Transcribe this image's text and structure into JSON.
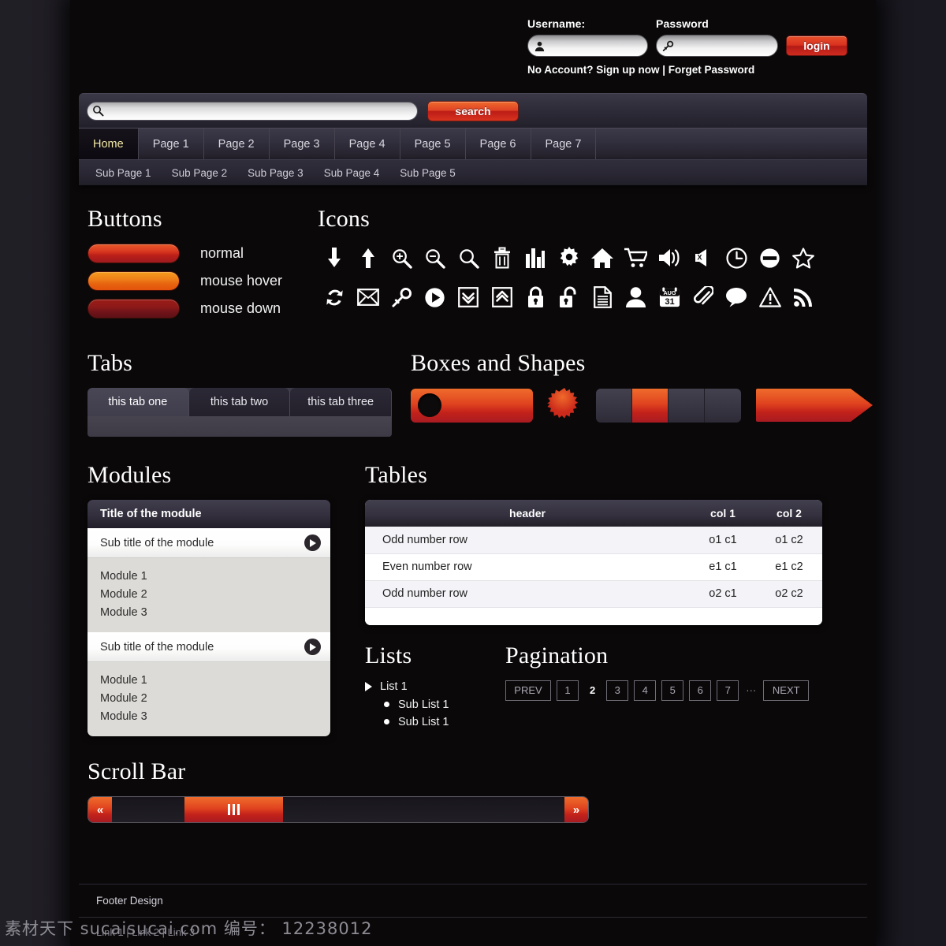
{
  "login": {
    "username_label": "Username:",
    "password_label": "Password",
    "username_value": "",
    "password_value": "",
    "username_placeholder": "",
    "password_placeholder": "",
    "login_button": "login",
    "helper_text": "No Account? Sign up now | Forget Password"
  },
  "search": {
    "value": "",
    "placeholder": "",
    "button": "search"
  },
  "nav": {
    "items": [
      {
        "label": "Home",
        "active": true
      },
      {
        "label": "Page 1",
        "active": false
      },
      {
        "label": "Page 2",
        "active": false
      },
      {
        "label": "Page 3",
        "active": false
      },
      {
        "label": "Page 4",
        "active": false
      },
      {
        "label": "Page 5",
        "active": false
      },
      {
        "label": "Page 6",
        "active": false
      },
      {
        "label": "Page 7",
        "active": false
      }
    ]
  },
  "subnav": {
    "items": [
      {
        "label": "Sub Page 1"
      },
      {
        "label": "Sub Page 2"
      },
      {
        "label": "Sub Page 3"
      },
      {
        "label": "Sub Page 4"
      },
      {
        "label": "Sub Page 5"
      }
    ]
  },
  "sections": {
    "buttons": "Buttons",
    "icons": "Icons",
    "tabs": "Tabs",
    "boxes": "Boxes and Shapes",
    "modules": "Modules",
    "tables": "Tables",
    "lists": "Lists",
    "pagination": "Pagination",
    "scrollbar": "Scroll Bar"
  },
  "buttons": [
    {
      "state": "normal",
      "label": "normal",
      "color": "#d8371f"
    },
    {
      "state": "mouse-hover",
      "label": "mouse hover",
      "color": "#ef8019"
    },
    {
      "state": "mouse-down",
      "label": "mouse down",
      "color": "#8d1a19"
    }
  ],
  "icons": {
    "row1": [
      "arrow-down-icon",
      "arrow-up-icon",
      "zoom-in-icon",
      "zoom-out-icon",
      "search-icon",
      "trash-icon",
      "bar-chart-icon",
      "gear-icon",
      "home-icon",
      "shopping-cart-icon",
      "volume-up-icon",
      "volume-mute-icon",
      "clock-icon",
      "block-circle-icon",
      "star-icon"
    ],
    "row2": [
      "refresh-icon",
      "envelope-icon",
      "key-icon",
      "play-circle-icon",
      "chevron-down-box-icon",
      "chevron-up-box-icon",
      "lock-closed-icon",
      "lock-open-icon",
      "document-icon",
      "user-icon",
      "calendar-icon",
      "paperclip-icon",
      "comment-icon",
      "warning-icon",
      "rss-icon"
    ],
    "calendar": {
      "month": "AUG",
      "day": "31"
    },
    "mute_mark": "X"
  },
  "tabs": [
    {
      "label": "this tab one",
      "active": true
    },
    {
      "label": "this tab two",
      "active": false
    },
    {
      "label": "this tab three",
      "active": false
    }
  ],
  "shapes": {
    "accent": "#e0431f",
    "segments_on_index": 1,
    "segment_count": 4
  },
  "modules": {
    "title": "Title of the module",
    "groups": [
      {
        "subtitle": "Sub title of the module",
        "items": [
          "Module 1",
          "Module 2",
          "Module 3"
        ]
      },
      {
        "subtitle": "Sub title of the module",
        "items": [
          "Module 1",
          "Module 2",
          "Module 3"
        ]
      }
    ]
  },
  "table": {
    "headers": [
      "header",
      "col 1",
      "col 2"
    ],
    "rows": [
      {
        "cells": [
          "Odd number row",
          "o1 c1",
          "o1 c2"
        ],
        "parity": "odd"
      },
      {
        "cells": [
          "Even number row",
          "e1 c1",
          "e1 c2"
        ],
        "parity": "even"
      },
      {
        "cells": [
          "Odd number row",
          "o2 c1",
          "o2 c2"
        ],
        "parity": "odd"
      }
    ]
  },
  "lists": {
    "top": "List 1",
    "children": [
      "Sub List 1",
      "Sub List 1"
    ]
  },
  "pagination": {
    "prev": "PREV",
    "next": "NEXT",
    "dots": "···",
    "pages": [
      "1",
      "2",
      "3",
      "4",
      "5",
      "6",
      "7"
    ],
    "current": "2"
  },
  "scrollbar": {
    "left_arrow": "«",
    "right_arrow": "»",
    "thumb_position_pct": 17,
    "thumb_width_pct": 22
  },
  "footer": {
    "title": "Footer Design",
    "links": "Link 1 | Link 2 | Link 3"
  },
  "watermark": "素材天下 sucaisucai.com 编号： 12238012"
}
